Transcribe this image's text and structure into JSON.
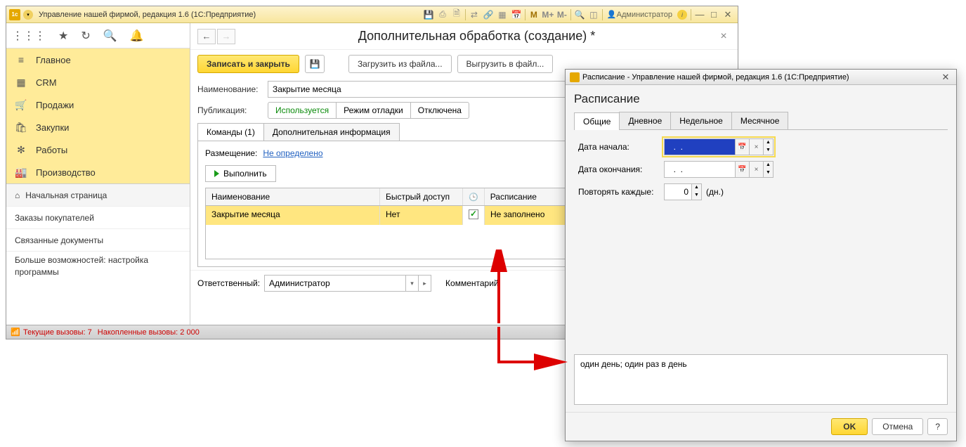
{
  "app_title": "Управление нашей фирмой, редакция 1.6  (1С:Предприятие)",
  "system_m_labels": [
    "M",
    "M+",
    "M-"
  ],
  "user_label": "Администратор",
  "sidebar": {
    "items": [
      {
        "icon": "≡",
        "label": "Главное"
      },
      {
        "icon": "▦",
        "label": "CRM"
      },
      {
        "icon": "🛒",
        "label": "Продажи"
      },
      {
        "icon": "🛍",
        "label": "Закупки"
      },
      {
        "icon": "✻",
        "label": "Работы"
      },
      {
        "icon": "🏭",
        "label": "Производство"
      }
    ],
    "sub": [
      {
        "label": "Начальная страница",
        "icon": "⌂"
      },
      {
        "label": "Заказы покупателей"
      },
      {
        "label": "Связанные документы"
      }
    ],
    "more": "Больше возможностей: настройка программы"
  },
  "content": {
    "title": "Дополнительная обработка (создание) *",
    "toolbar": {
      "save_close": "Записать и закрыть",
      "load": "Загрузить из файла...",
      "unload": "Выгрузить в файл..."
    },
    "fields": {
      "name_label": "Наименование:",
      "name_value": "Закрытие месяца",
      "pub_label": "Публикация:",
      "pub_opts": [
        "Используется",
        "Режим отладки",
        "Отключена"
      ]
    },
    "tabs": [
      "Команды (1)",
      "Дополнительная информация"
    ],
    "placement_label": "Размещение:",
    "placement_link": "Не определено",
    "exec_btn": "Выполнить",
    "grid": {
      "cols": [
        "Наименование",
        "Быстрый доступ",
        "",
        "Расписание"
      ],
      "row": {
        "name": "Закрытие месяца",
        "quick": "Нет",
        "checked": true,
        "sched": "Не заполнено"
      }
    },
    "resp_label": "Ответственный:",
    "resp_value": "Администратор",
    "comment_label": "Комментарий:"
  },
  "statusbar": {
    "current": "Текущие вызовы: 7",
    "saved": "Накопленные вызовы: 2 000"
  },
  "popup": {
    "title": "Расписание - Управление нашей фирмой, редакция 1.6  (1С:Предприятие)",
    "heading": "Расписание",
    "tabs": [
      "Общие",
      "Дневное",
      "Недельное",
      "Месячное"
    ],
    "start_label": "Дата начала:",
    "start_value": "  .  .    ",
    "end_label": "Дата окончания:",
    "end_value": "  .  .    ",
    "repeat_label": "Повторять каждые:",
    "repeat_value": "0",
    "repeat_unit": "(дн.)",
    "summary": "один день; один раз в день",
    "ok": "OK",
    "cancel": "Отмена",
    "help": "?"
  }
}
